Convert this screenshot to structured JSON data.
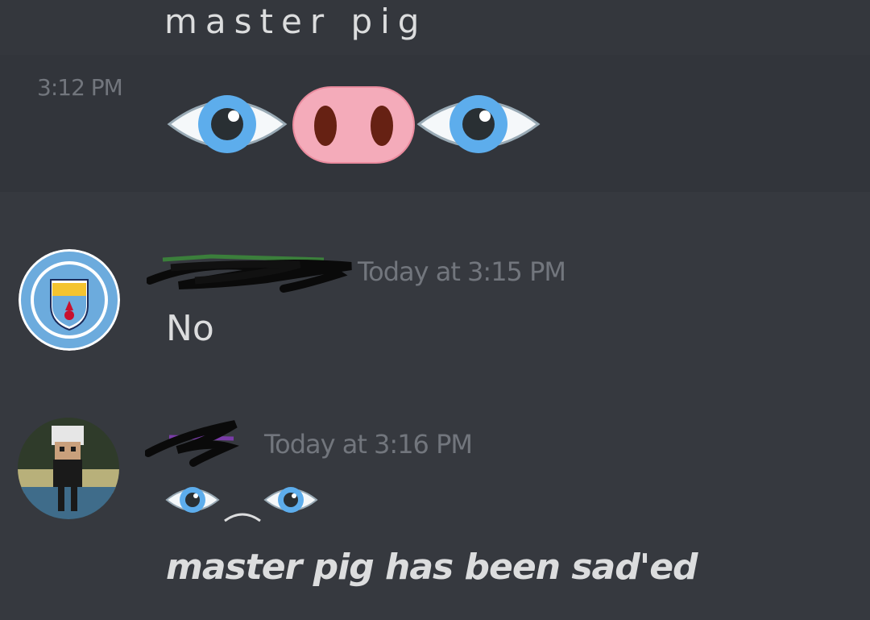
{
  "messages": {
    "previous": {
      "text": "master pig",
      "compact_time": "3:12 PM",
      "emojis": [
        "eye-icon",
        "pig-nose-icon",
        "eye-icon"
      ]
    },
    "first": {
      "author_avatar": "manchester-city-badge",
      "timestamp": "Today at 3:15 PM",
      "text": "No"
    },
    "second": {
      "author_avatar": "pixel-character-avatar",
      "timestamp": "Today at 3:16 PM",
      "emojis": [
        "eye-icon",
        "frown-mouth-icon",
        "eye-icon"
      ],
      "text": "master pig has been sad'ed"
    }
  },
  "colors": {
    "background": "#36393f",
    "hover_background": "#32353b",
    "text": "#dcddde",
    "muted": "#72767d",
    "eye_blue": "#5dadec",
    "pig_nose": "#f4abba"
  }
}
